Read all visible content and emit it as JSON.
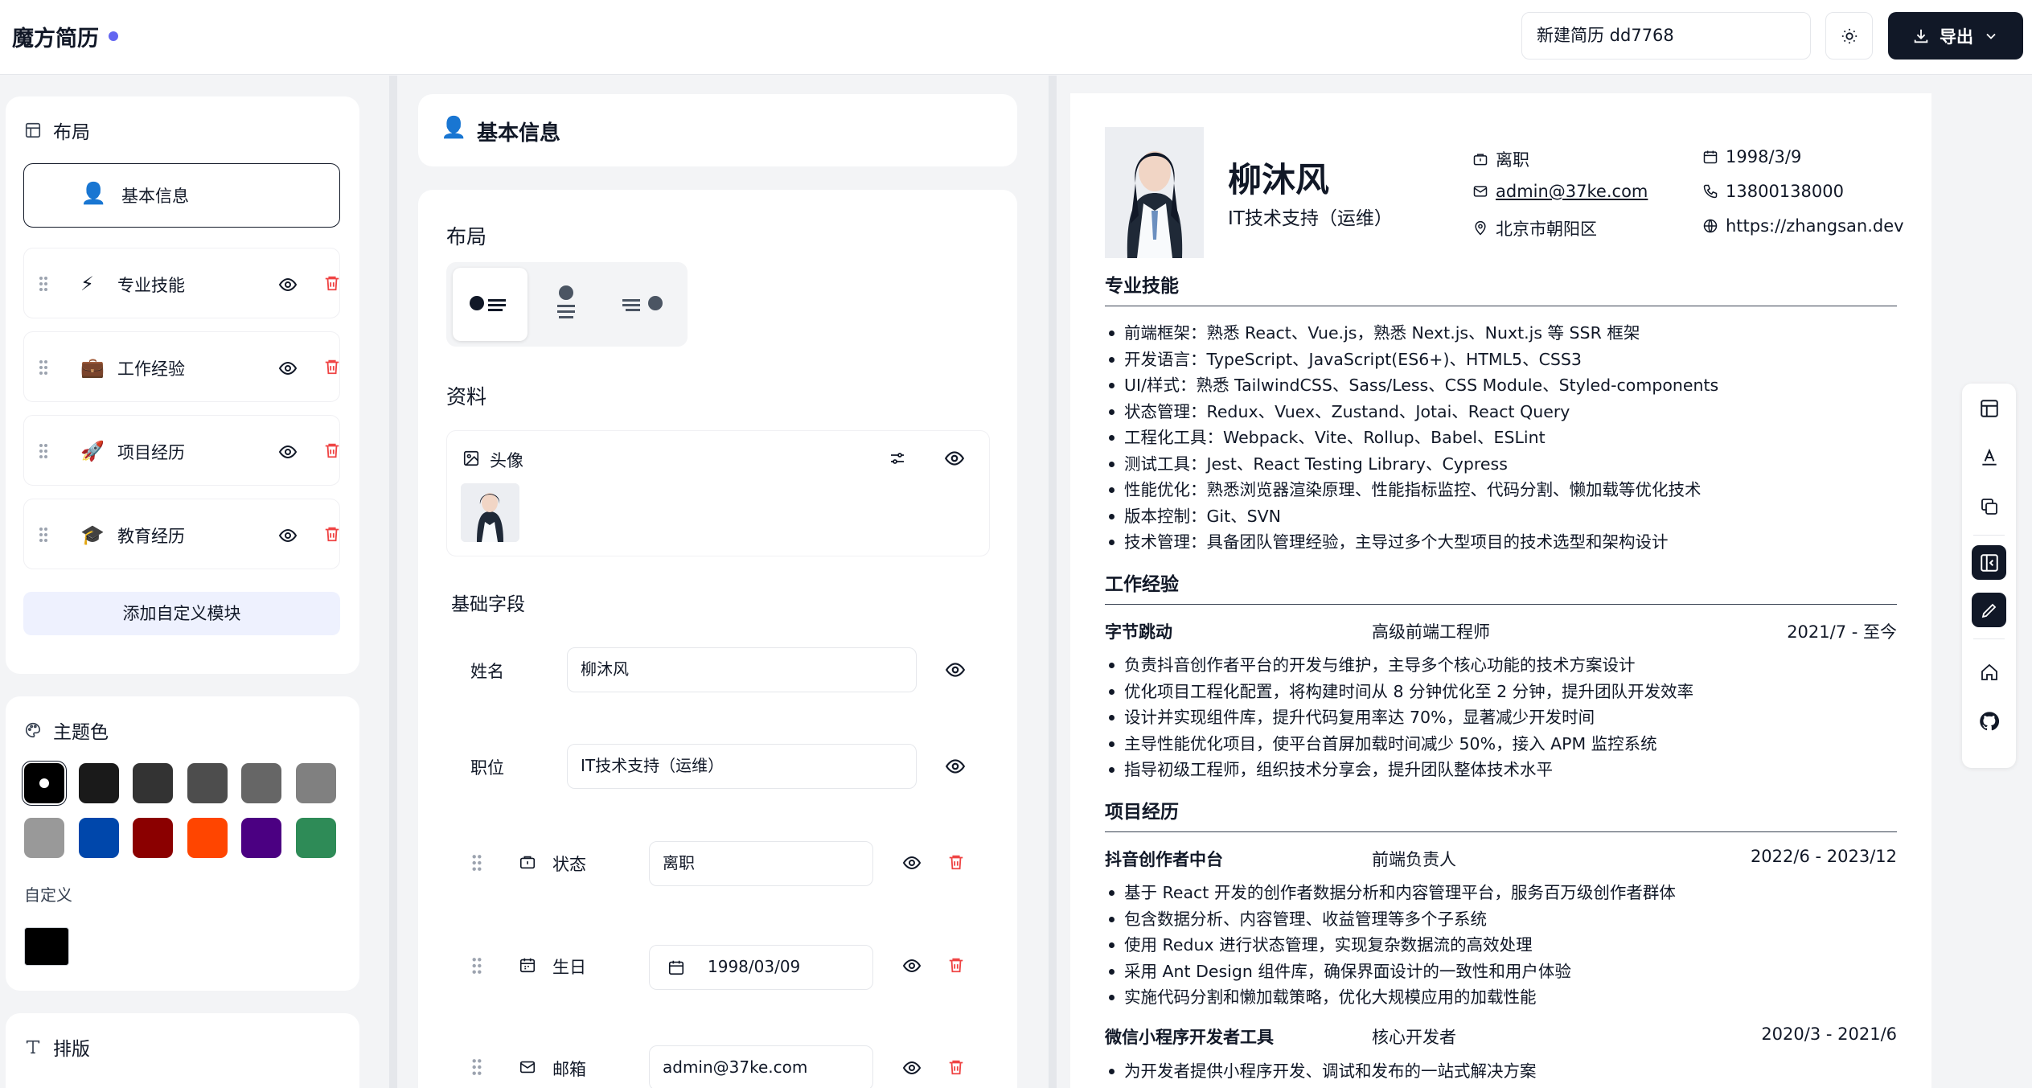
{
  "app": {
    "brand": "魔方简历",
    "accent": "#6366f1"
  },
  "header": {
    "resume_name": "新建简历 dd7768",
    "export_label": "导出"
  },
  "left": {
    "layout_title": "布局",
    "active_module": {
      "emoji": "👤",
      "label": "基本信息"
    },
    "modules": [
      {
        "emoji": "⚡",
        "label": "专业技能"
      },
      {
        "emoji": "💼",
        "label": "工作经验"
      },
      {
        "emoji": "🚀",
        "label": "项目经历"
      },
      {
        "emoji": "🎓",
        "label": "教育经历"
      }
    ],
    "add_module_label": "添加自定义模块",
    "theme_title": "主题色",
    "theme_colors": [
      "#000000",
      "#1a1a1a",
      "#333333",
      "#4d4d4d",
      "#666666",
      "#808080",
      "#999999",
      "#0047ab",
      "#8b0000",
      "#ff4500",
      "#4b0082",
      "#2e8b57"
    ],
    "custom_label": "自定义",
    "custom_color": "#000000",
    "typography_title": "排版"
  },
  "mid": {
    "header_emoji": "👤",
    "header_title": "基本信息",
    "layout_label": "布局",
    "data_label": "资料",
    "avatar_label": "头像",
    "basic_fields_label": "基础字段",
    "fields": {
      "name_label": "姓名",
      "name_value": "柳沐风",
      "title_label": "职位",
      "title_value": "IT技术支持（运维）",
      "status_label": "状态",
      "status_value": "离职",
      "birth_label": "生日",
      "birth_value": "1998/03/09",
      "email_label": "邮箱",
      "email_value": "admin@37ke.com"
    }
  },
  "resume": {
    "name": "柳沐风",
    "title": "IT技术支持（运维）",
    "contacts": {
      "status": "离职",
      "birth": "1998/3/9",
      "email": "admin@37ke.com",
      "phone": "13800138000",
      "location": "北京市朝阳区",
      "website": "https://zhangsan.dev"
    },
    "skills_title": "专业技能",
    "skills": [
      "前端框架：熟悉 React、Vue.js，熟悉 Next.js、Nuxt.js 等 SSR 框架",
      "开发语言：TypeScript、JavaScript(ES6+)、HTML5、CSS3",
      "UI/样式：熟悉 TailwindCSS、Sass/Less、CSS Module、Styled-components",
      "状态管理：Redux、Vuex、Zustand、Jotai、React Query",
      "工程化工具：Webpack、Vite、Rollup、Babel、ESLint",
      "测试工具：Jest、React Testing Library、Cypress",
      "性能优化：熟悉浏览器渲染原理、性能指标监控、代码分割、懒加载等优化技术",
      "版本控制：Git、SVN",
      "技术管理：具备团队管理经验，主导过多个大型项目的技术选型和架构设计"
    ],
    "work_title": "工作经验",
    "work": {
      "company": "字节跳动",
      "role": "高级前端工程师",
      "period": "2021/7 - 至今",
      "items": [
        "负责抖音创作者平台的开发与维护，主导多个核心功能的技术方案设计",
        "优化项目工程化配置，将构建时间从 8 分钟优化至 2 分钟，提升团队开发效率",
        "设计并实现组件库，提升代码复用率达 70%，显著减少开发时间",
        "主导性能优化项目，使平台首屏加载时间减少 50%，接入 APM 监控系统",
        "指导初级工程师，组织技术分享会，提升团队整体技术水平"
      ]
    },
    "project_title": "项目经历",
    "project1": {
      "name": "抖音创作者中台",
      "role": "前端负责人",
      "period": "2022/6 - 2023/12",
      "items": [
        "基于 React 开发的创作者数据分析和内容管理平台，服务百万级创作者群体",
        "包含数据分析、内容管理、收益管理等多个子系统",
        "使用 Redux 进行状态管理，实现复杂数据流的高效处理",
        "采用 Ant Design 组件库，确保界面设计的一致性和用户体验",
        "实施代码分割和懒加载策略，优化大规模应用的加载性能"
      ]
    },
    "project2": {
      "name": "微信小程序开发者工具",
      "role": "核心开发者",
      "period": "2020/3 - 2021/6",
      "items": [
        "为开发者提供小程序开发、调试和发布的一站式解决方案"
      ]
    }
  }
}
